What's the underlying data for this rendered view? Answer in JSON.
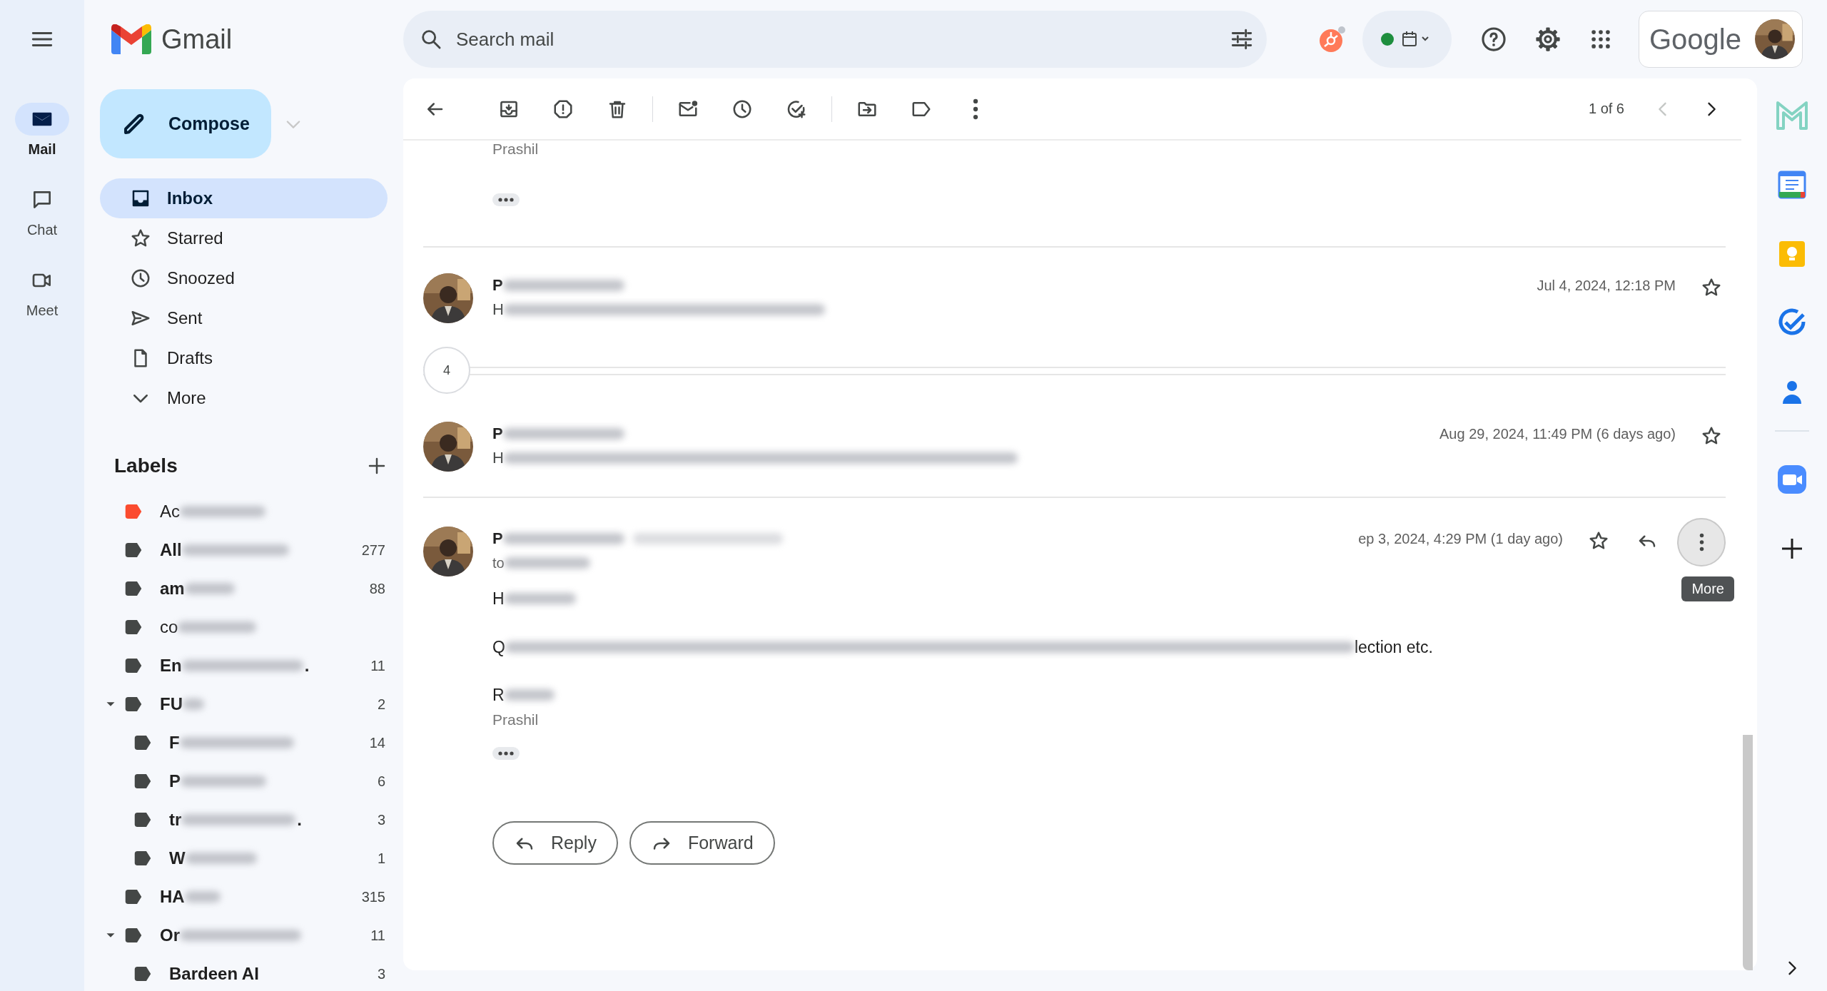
{
  "rail": [
    {
      "label": "Mail",
      "selected": true
    },
    {
      "label": "Chat",
      "selected": false
    },
    {
      "label": "Meet",
      "selected": false
    }
  ],
  "app": {
    "name": "Gmail"
  },
  "compose": {
    "label": "Compose"
  },
  "nav": [
    {
      "label": "Inbox",
      "selected": true
    },
    {
      "label": "Starred",
      "selected": false
    },
    {
      "label": "Snoozed",
      "selected": false
    },
    {
      "label": "Sent",
      "selected": false
    },
    {
      "label": "Drafts",
      "selected": false
    },
    {
      "label": "More",
      "selected": false
    }
  ],
  "labels_title": "Labels",
  "labels": [
    {
      "name": "Ac",
      "color": "#fb4c2f",
      "unread": false
    },
    {
      "name": "All",
      "count": "277",
      "color": "#444746",
      "unread": true
    },
    {
      "name": "am",
      "count": "88",
      "color": "#444746",
      "unread": true
    },
    {
      "name": "co",
      "color": "#444746",
      "unread": false
    },
    {
      "name": "En",
      "trail": ".",
      "count": "11",
      "color": "#444746",
      "unread": true
    },
    {
      "name": "FU",
      "count": "2",
      "color": "#444746",
      "unread": true,
      "expanded": true,
      "children": [
        {
          "name": "F",
          "count": "14",
          "color": "#444746",
          "unread": true
        },
        {
          "name": "P",
          "count": "6",
          "color": "#444746",
          "unread": true
        },
        {
          "name": "tr",
          "trail": ".",
          "count": "3",
          "color": "#444746",
          "unread": true
        },
        {
          "name": "W",
          "count": "1",
          "color": "#444746",
          "unread": true
        }
      ]
    },
    {
      "name": "HA",
      "count": "315",
      "color": "#444746",
      "unread": true
    },
    {
      "name": "Or",
      "count": "11",
      "color": "#444746",
      "unread": true,
      "expanded": true,
      "children": [
        {
          "name": "Bardeen AI",
          "count": "3",
          "color": "#444746",
          "unread": true
        }
      ]
    }
  ],
  "search": {
    "placeholder": "Search mail"
  },
  "account": {
    "brand": "Google"
  },
  "toolbar": {
    "pager": "1 of 6"
  },
  "messages": [
    {
      "kind": "tail",
      "signature": "Prashil"
    },
    {
      "kind": "collapsed",
      "name": "P",
      "snippet": "H",
      "date": "Jul 4, 2024, 12:18 PM",
      "starred": false
    },
    {
      "kind": "count",
      "count": "4"
    },
    {
      "kind": "collapsed",
      "name": "P",
      "snippet": "H",
      "date": "Aug 29, 2024, 11:49 PM (6 days ago)",
      "starred": false
    },
    {
      "kind": "expanded",
      "name": "P",
      "to": "to",
      "date": "ep 3, 2024, 4:29 PM (1 day ago)",
      "starred": false,
      "tooltip": "More",
      "body": [
        {
          "text": "H"
        },
        {
          "text": "Q",
          "tail": "lection etc."
        },
        {
          "text": "R"
        }
      ],
      "signature": "Prashil"
    }
  ],
  "actions": [
    {
      "kind": "reply",
      "label": "Reply"
    },
    {
      "kind": "forward",
      "label": "Forward"
    }
  ]
}
